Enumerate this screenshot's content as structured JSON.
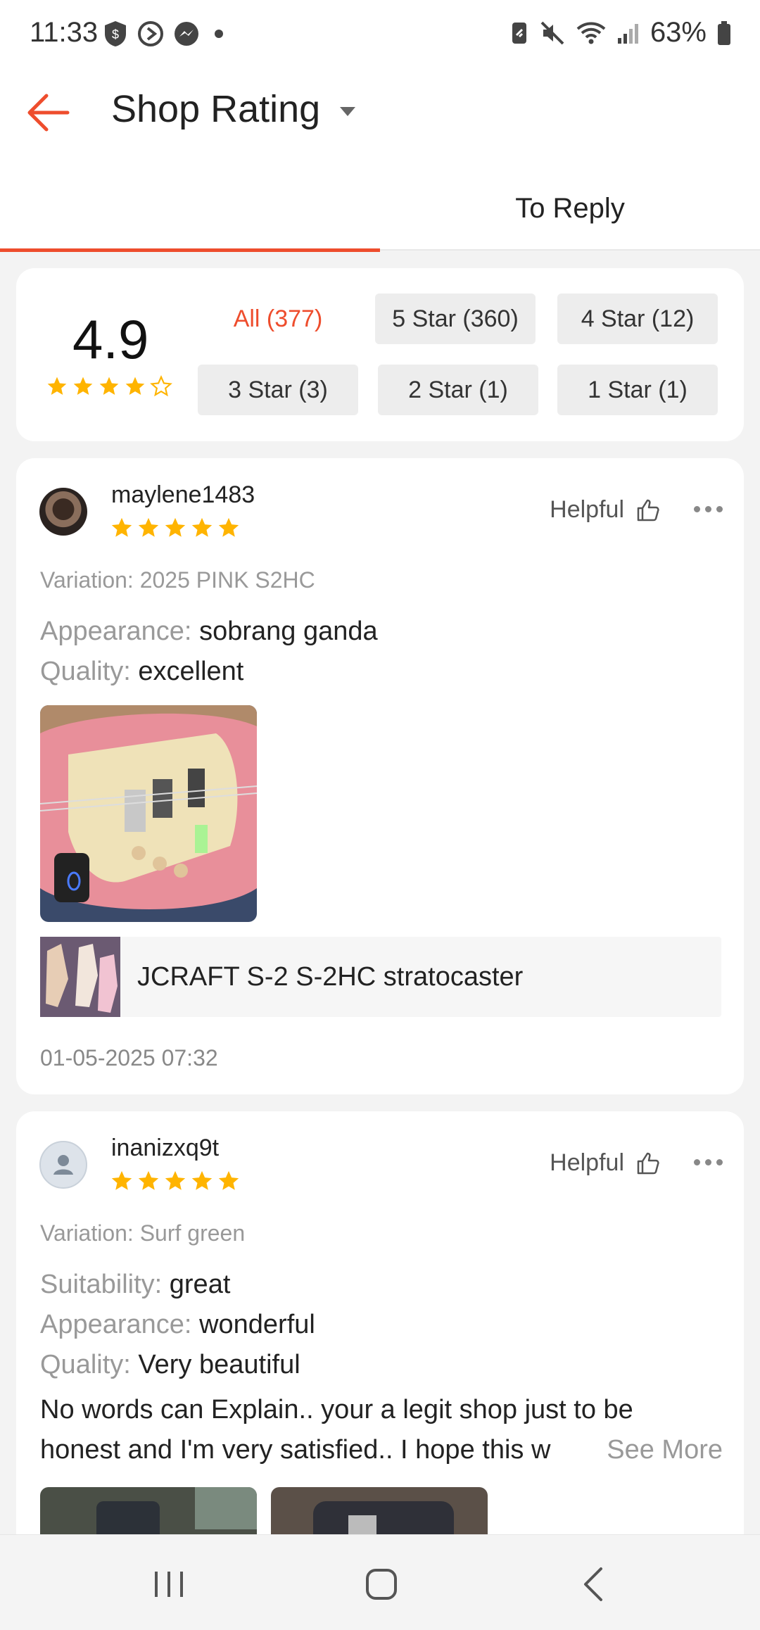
{
  "status_bar": {
    "time": "11:33",
    "battery": "63%",
    "left_icons": [
      "shield-dollar-icon",
      "smart-switch-icon",
      "messenger-icon",
      "dot-icon"
    ],
    "right_icons": [
      "battery-saver-icon",
      "mute-icon",
      "wifi-icon",
      "signal-icon",
      "battery-icon"
    ]
  },
  "header": {
    "title": "Shop Rating",
    "back_icon": "back-arrow-icon",
    "dropdown_icon": "caret-down-icon"
  },
  "tabs": [
    {
      "label": "",
      "active": true
    },
    {
      "label": "To Reply",
      "active": false
    }
  ],
  "summary": {
    "score": "4.9",
    "stars_filled": 4,
    "stars_total": 5,
    "filters": [
      {
        "label": "All (377)",
        "active": true
      },
      {
        "label": "5 Star (360)",
        "active": false
      },
      {
        "label": "4 Star (12)",
        "active": false
      },
      {
        "label": "3 Star (3)",
        "active": false
      },
      {
        "label": "2 Star (1)",
        "active": false
      },
      {
        "label": "1 Star (1)",
        "active": false
      }
    ]
  },
  "reviews": [
    {
      "username": "maylene1483",
      "stars": 5,
      "helpful_label": "Helpful",
      "variation": "Variation: 2025 PINK S2HC",
      "attributes": [
        {
          "key": "Appearance:",
          "value": "sobrang ganda"
        },
        {
          "key": "Quality:",
          "value": "excellent"
        }
      ],
      "product_name": "JCRAFT S-2 S-2HC stratocaster",
      "date": "01-05-2025 07:32"
    },
    {
      "username": "inanizxq9t",
      "stars": 5,
      "helpful_label": "Helpful",
      "variation": "Variation: Surf green",
      "attributes": [
        {
          "key": "Suitability:",
          "value": "great"
        },
        {
          "key": "Appearance:",
          "value": "wonderful"
        },
        {
          "key": "Quality:",
          "value": "Very beautiful"
        }
      ],
      "comment_line1": "No words can Explain.. your a legit shop just to be",
      "comment_line2": "honest and I'm very satisfied..  I hope this w",
      "see_more": "See More"
    }
  ],
  "colors": {
    "accent": "#ee4d2d",
    "star": "#ffb400",
    "chip_bg": "#ededed"
  }
}
